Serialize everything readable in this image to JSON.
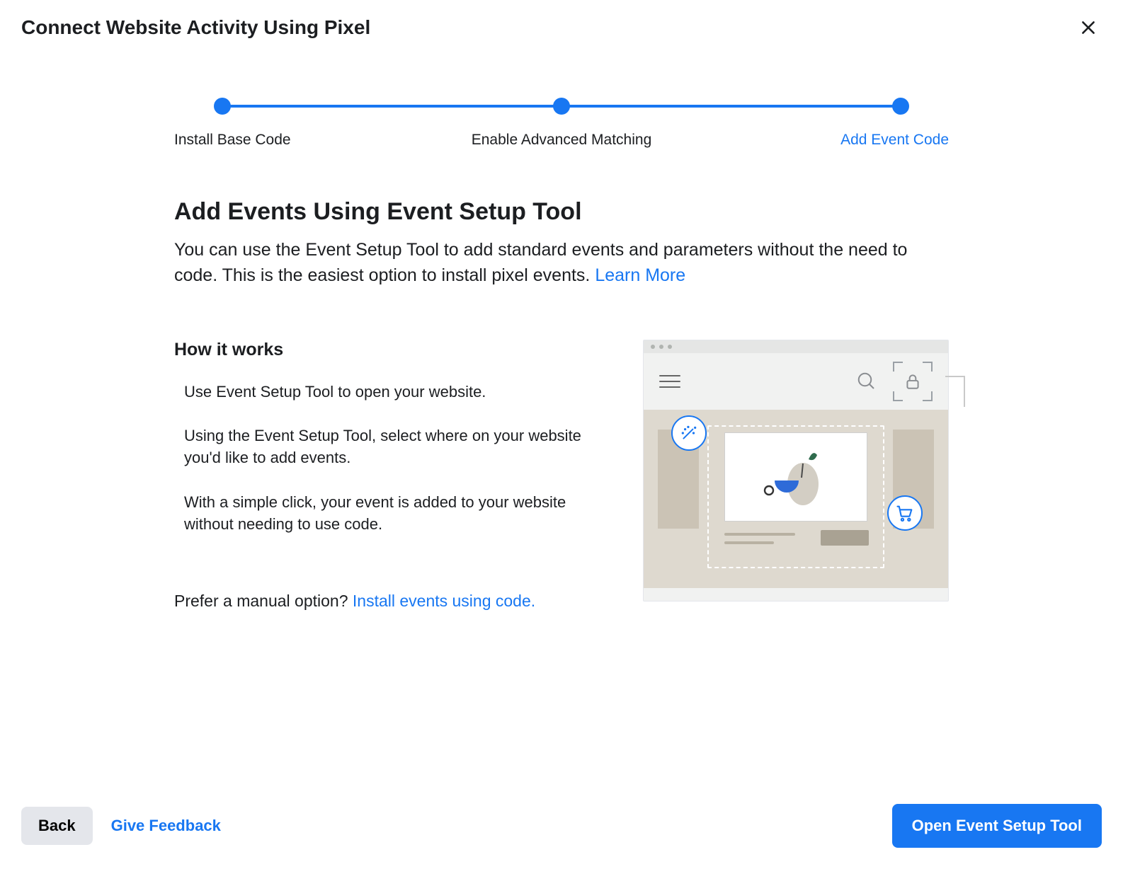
{
  "header": {
    "title": "Connect Website Activity Using Pixel"
  },
  "stepper": {
    "steps": [
      {
        "label": "Install Base Code"
      },
      {
        "label": "Enable Advanced Matching"
      },
      {
        "label": "Add Event Code"
      }
    ],
    "active_index": 2
  },
  "section": {
    "title": "Add Events Using Event Setup Tool",
    "desc_before_link": "You can use the Event Setup Tool to add standard events and parameters without the need to code. This is the easiest option to install pixel events. ",
    "learn_more": "Learn More"
  },
  "how_it_works": {
    "title": "How it works",
    "steps": [
      "Use Event Setup Tool to open your website.",
      "Using the Event Setup Tool, select where on your website you'd like to add events.",
      "With a simple click, your event is added to your website without needing to use code."
    ]
  },
  "manual": {
    "prefix": "Prefer a manual option? ",
    "link": "Install events using code."
  },
  "footer": {
    "back": "Back",
    "feedback": "Give Feedback",
    "primary": "Open Event Setup Tool"
  },
  "icons": {
    "close": "close-icon",
    "hamburger": "hamburger-icon",
    "search": "search-icon",
    "lock": "lock-icon",
    "wand": "magic-wand-icon",
    "cart": "shopping-cart-icon"
  }
}
